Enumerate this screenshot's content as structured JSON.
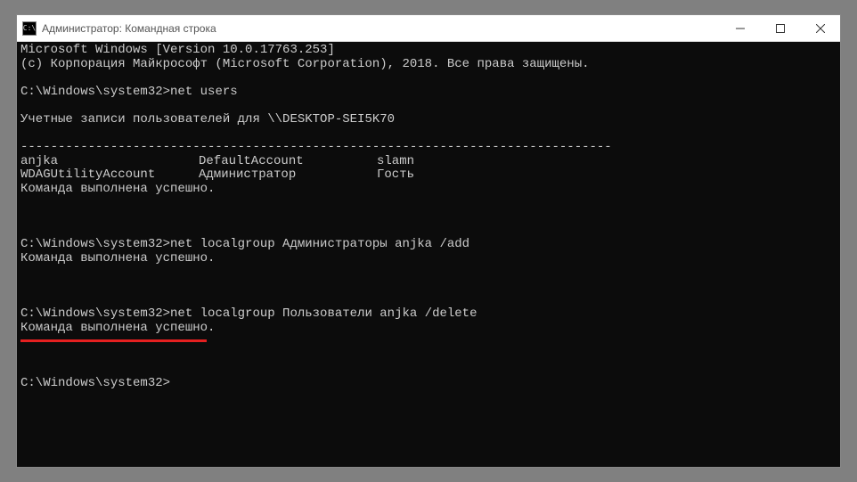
{
  "titlebar": {
    "icon_label": "C:\\",
    "title": "Администратор: Командная строка"
  },
  "terminal": {
    "header_version": "Microsoft Windows [Version 10.0.17763.253]",
    "header_copyright": "(c) Корпорация Майкрософт (Microsoft Corporation), 2018. Все права защищены.",
    "prompt": "C:\\Windows\\system32>",
    "cmd1": "net users",
    "accounts_header": "Учетные записи пользователей для \\\\DESKTOP-SEI5K70",
    "divider": "-------------------------------------------------------------------------------",
    "row1": {
      "c1": "anjka",
      "c2": "DefaultAccount",
      "c3": "slamn"
    },
    "row2": {
      "c1": "WDAGUtilityAccount",
      "c2": "Администратор",
      "c3": "Гость"
    },
    "success": "Команда выполнена успешно.",
    "cmd2": "net localgroup Администраторы anjka /add",
    "cmd3": "net localgroup Пользователи anjka /delete"
  }
}
